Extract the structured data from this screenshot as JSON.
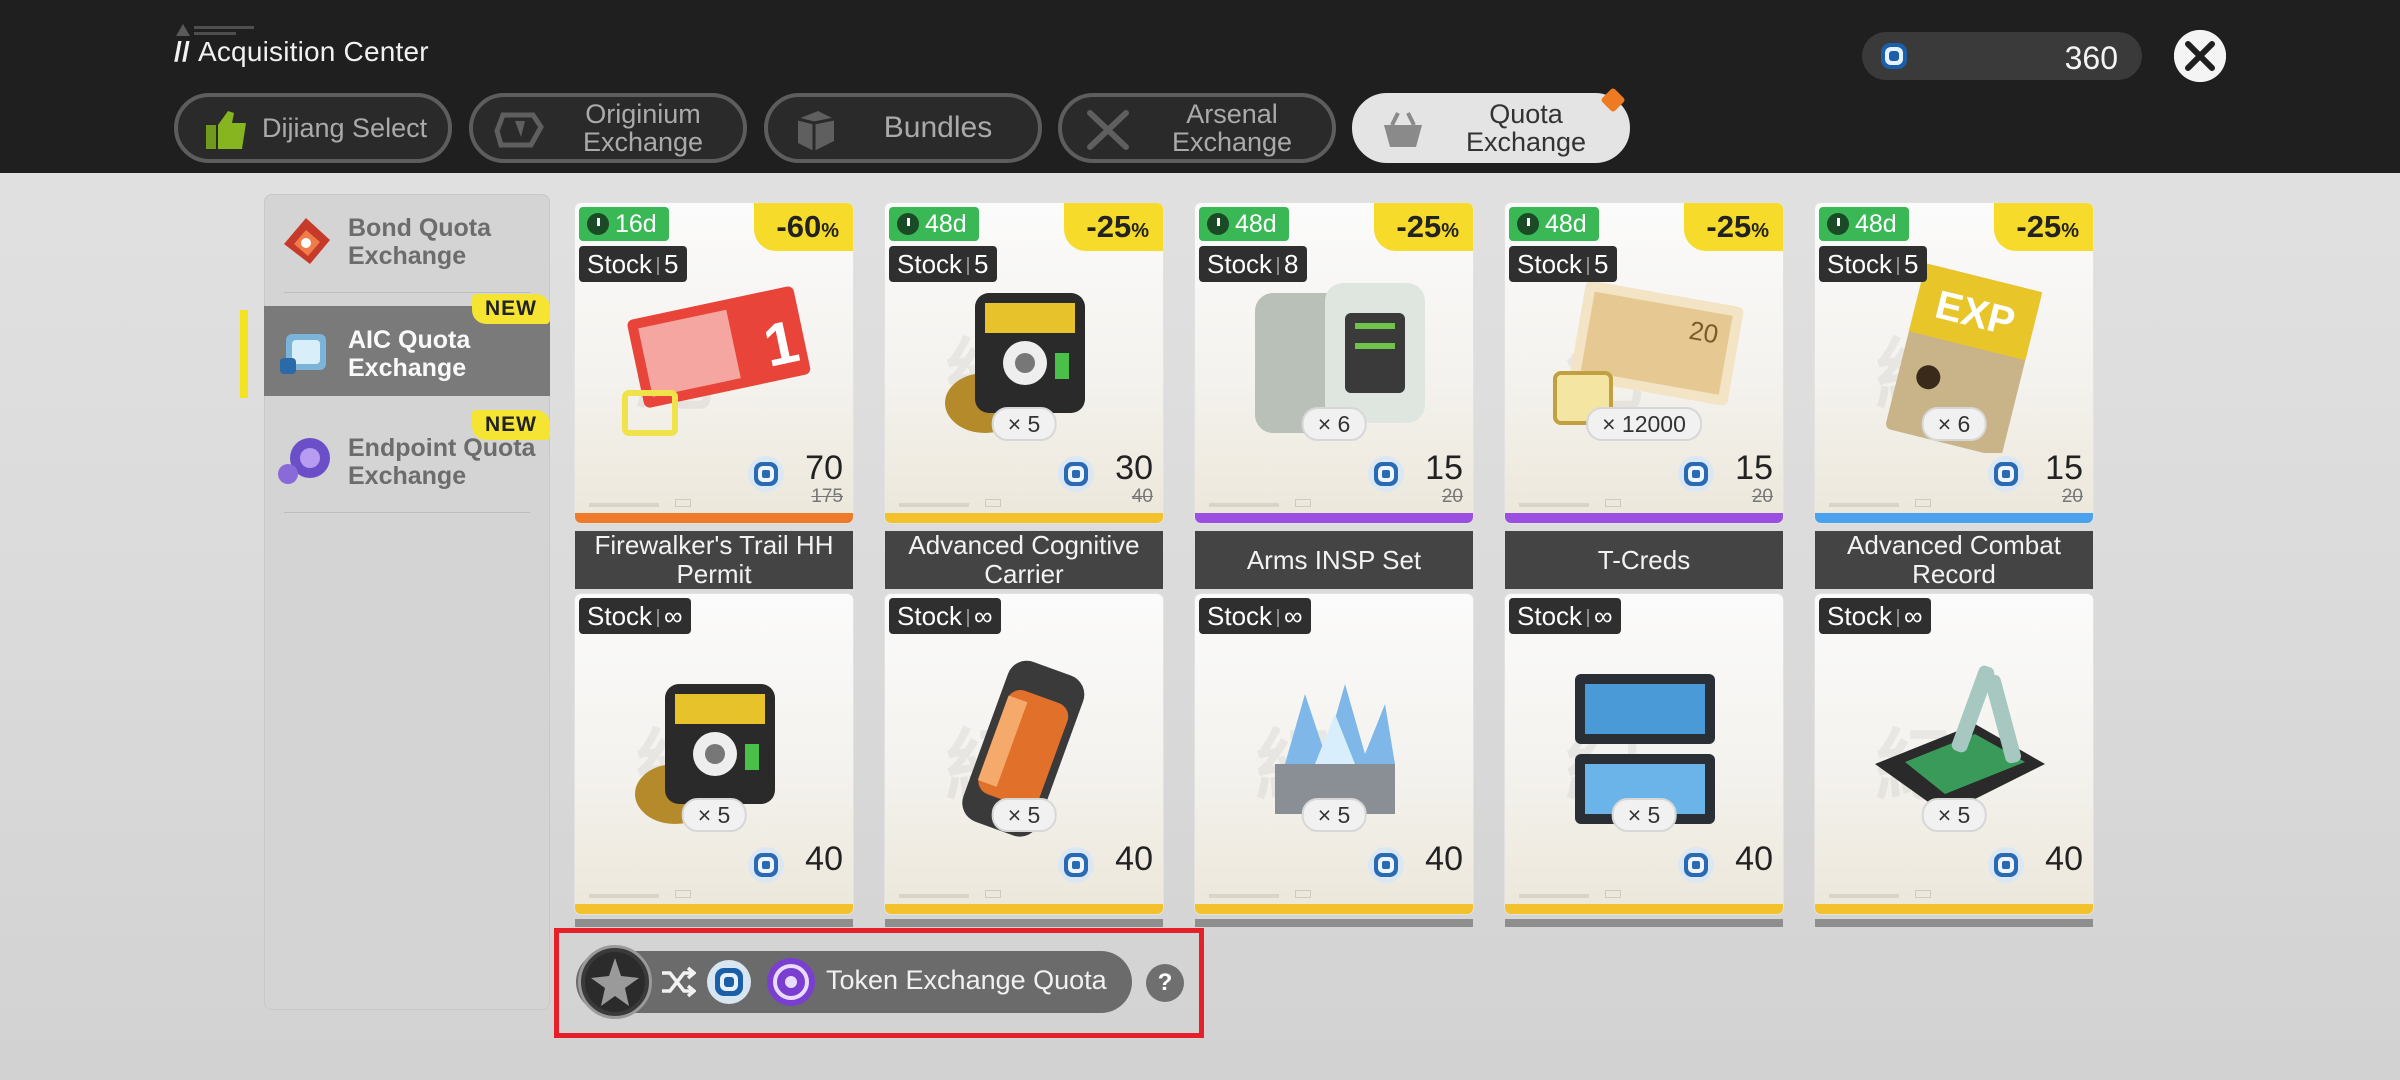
{
  "header": {
    "title": "Acquisition Center",
    "title_prefix": "//",
    "currency_value": "360",
    "close_label": "Close"
  },
  "tabs": [
    {
      "label": "Dijiang Select",
      "active": false
    },
    {
      "label": "Originium Exchange",
      "active": false
    },
    {
      "label": "Bundles",
      "active": false
    },
    {
      "label": "Arsenal Exchange",
      "active": false
    },
    {
      "label": "Quota Exchange",
      "active": true
    }
  ],
  "sidebar": {
    "items": [
      {
        "label": "Bond Quota Exchange",
        "active": false,
        "new": false
      },
      {
        "label": "AIC Quota Exchange",
        "active": true,
        "new": true
      },
      {
        "label": "Endpoint Quota Exchange",
        "active": false,
        "new": true
      }
    ],
    "new_label": "NEW"
  },
  "shop": {
    "stock_label": "Stock",
    "row1": [
      {
        "timer": "16d",
        "discount": "-60",
        "discount_unit": "%",
        "stock": "5",
        "qty": "",
        "price": "70",
        "old_price": "175",
        "name": "Firewalker's Trail HH Permit",
        "bar_color": "#ee7a2a"
      },
      {
        "timer": "48d",
        "discount": "-25",
        "discount_unit": "%",
        "stock": "5",
        "qty": "× 5",
        "price": "30",
        "old_price": "40",
        "name": "Advanced Cognitive Carrier",
        "bar_color": "#f2c12b"
      },
      {
        "timer": "48d",
        "discount": "-25",
        "discount_unit": "%",
        "stock": "8",
        "qty": "× 6",
        "price": "15",
        "old_price": "20",
        "name": "Arms INSP Set",
        "bar_color": "#9b4fe0"
      },
      {
        "timer": "48d",
        "discount": "-25",
        "discount_unit": "%",
        "stock": "5",
        "qty": "× 12000",
        "price": "15",
        "old_price": "20",
        "name": "T-Creds",
        "bar_color": "#9b4fe0"
      },
      {
        "timer": "48d",
        "discount": "-25",
        "discount_unit": "%",
        "stock": "5",
        "qty": "× 6",
        "price": "15",
        "old_price": "20",
        "name": "Advanced Combat Record",
        "bar_color": "#4aa2ee"
      }
    ],
    "row2": [
      {
        "stock": "∞",
        "qty": "× 5",
        "price": "40",
        "bar_color": "#f2c12b"
      },
      {
        "stock": "∞",
        "qty": "× 5",
        "price": "40",
        "bar_color": "#f2c12b"
      },
      {
        "stock": "∞",
        "qty": "× 5",
        "price": "40",
        "bar_color": "#f2c12b"
      },
      {
        "stock": "∞",
        "qty": "× 5",
        "price": "40",
        "bar_color": "#f2c12b"
      },
      {
        "stock": "∞",
        "qty": "× 5",
        "price": "40",
        "bar_color": "#f2c12b"
      }
    ]
  },
  "footer": {
    "quota_label": "Token Exchange Quota",
    "help_label": "?"
  },
  "colors": {
    "accent_yellow": "#f6db2a",
    "timer_green": "#3ab856",
    "highlight_red": "#e5202a"
  }
}
